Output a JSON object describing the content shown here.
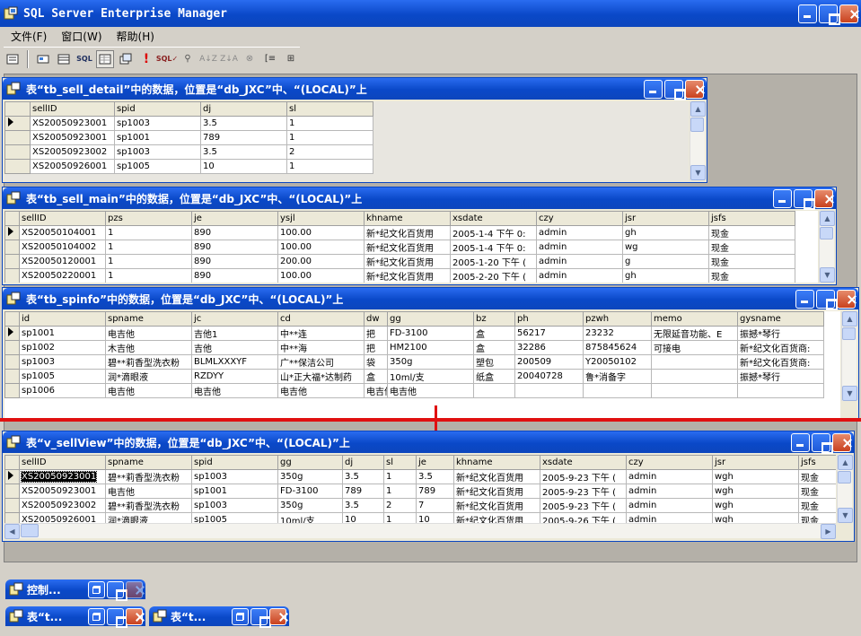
{
  "app": {
    "title": "SQL Server Enterprise Manager"
  },
  "menu": [
    {
      "label": "文件(F)"
    },
    {
      "label": "窗口(W)"
    },
    {
      "label": "帮助(H)"
    }
  ],
  "toolbar_icons": [
    "properties-icon",
    "show-diagram-pane-icon",
    "show-grid-pane-icon",
    "show-sql-pane-icon",
    "show-results-pane-icon",
    "change-query-type-icon",
    "run-icon",
    "verify-sql-icon",
    "remove-filter-icon",
    "sort-ascending-icon",
    "sort-descending-icon",
    "clear-filter-icon",
    "group-by-icon",
    "add-table-icon"
  ],
  "win1": {
    "title": "表“tb_sell_detail”中的数据，位置是“db_JXC”中、“(LOCAL)”上",
    "columns": [
      "sellID",
      "spid",
      "dj",
      "sl"
    ],
    "rows": [
      [
        "XS20050923001",
        "sp1003",
        "3.5",
        "1"
      ],
      [
        "XS20050923001",
        "sp1001",
        "789",
        "1"
      ],
      [
        "XS20050923002",
        "sp1003",
        "3.5",
        "2"
      ],
      [
        "XS20050926001",
        "sp1005",
        "10",
        "1"
      ]
    ]
  },
  "win2": {
    "title": "表“tb_sell_main”中的数据，位置是“db_JXC”中、“(LOCAL)”上",
    "columns": [
      "sellID",
      "pzs",
      "je",
      "ysjl",
      "khname",
      "xsdate",
      "czy",
      "jsr",
      "jsfs"
    ],
    "rows": [
      [
        "XS20050104001",
        "1",
        "890",
        "100.00",
        "新*纪文化百货用",
        "2005-1-4 下午 0:",
        "admin",
        "gh",
        "现金"
      ],
      [
        "XS20050104002",
        "1",
        "890",
        "100.00",
        "新*纪文化百货用",
        "2005-1-4 下午 0:",
        "admin",
        "wg",
        "现金"
      ],
      [
        "XS20050120001",
        "1",
        "890",
        "200.00",
        "新*纪文化百货用",
        "2005-1-20 下午 (",
        "admin",
        "g",
        "现金"
      ],
      [
        "XS20050220001",
        "1",
        "890",
        "100.00",
        "新*纪文化百货用",
        "2005-2-20 下午 (",
        "admin",
        "gh",
        "现金"
      ]
    ]
  },
  "win3": {
    "title": "表“tb_spinfo”中的数据，位置是“db_JXC”中、“(LOCAL)”上",
    "columns": [
      "id",
      "spname",
      "jc",
      "cd",
      "dw",
      "gg",
      "bz",
      "ph",
      "pzwh",
      "memo",
      "gysname"
    ],
    "rows": [
      [
        "sp1001",
        "电吉他",
        "吉他1",
        "中**连",
        "把",
        "FD-3100",
        "盒",
        "56217",
        "23232",
        "无限延音功能、E",
        "振撼*琴行"
      ],
      [
        "sp1002",
        "木吉他",
        "吉他",
        "中**海",
        "把",
        "HM2100",
        "盒",
        "32286",
        "875845624",
        "可接电",
        "新*纪文化百货商:"
      ],
      [
        "sp1003",
        "碧**莉香型洗衣粉",
        "BLMLXXXYF",
        "广**保洁公司",
        "袋",
        "350g",
        "塑包",
        "200509",
        "Y20050102",
        "",
        "新*纪文化百货商:"
      ],
      [
        "sp1005",
        "润*滴眼液",
        "RZDYY",
        "山*正大福*达制药",
        "盒",
        "10ml/支",
        "纸盒",
        "20040728",
        "鲁*消备字",
        "",
        "振撼*琴行"
      ],
      [
        "sp1006",
        "电吉他",
        "电吉他",
        "电吉他",
        "电吉他",
        "电吉他",
        "",
        "",
        "",
        "",
        ""
      ]
    ]
  },
  "win4": {
    "title": "表“v_sellView”中的数据，位置是“db_JXC”中、“(LOCAL)”上",
    "columns": [
      "sellID",
      "spname",
      "spid",
      "gg",
      "dj",
      "sl",
      "je",
      "khname",
      "xsdate",
      "czy",
      "jsr",
      "jsfs"
    ],
    "rows": [
      [
        "XS20050923001",
        "碧**莉香型洗衣粉",
        "sp1003",
        "350g",
        "3.5",
        "1",
        "3.5",
        "新*纪文化百货用",
        "2005-9-23 下午 (",
        "admin",
        "wgh",
        "现金"
      ],
      [
        "XS20050923001",
        "电吉他",
        "sp1001",
        "FD-3100",
        "789",
        "1",
        "789",
        "新*纪文化百货用",
        "2005-9-23 下午 (",
        "admin",
        "wgh",
        "现金"
      ],
      [
        "XS20050923002",
        "碧**莉香型洗衣粉",
        "sp1003",
        "350g",
        "3.5",
        "2",
        "7",
        "新*纪文化百货用",
        "2005-9-23 下午 (",
        "admin",
        "wgh",
        "现金"
      ],
      [
        "XS20050926001",
        "润*滴眼液",
        "sp1005",
        "10ml/支",
        "10",
        "1",
        "10",
        "新*纪文化百货用",
        "2005-9-26 下午 (",
        "admin",
        "wgh",
        "现金"
      ]
    ]
  },
  "minimized": [
    {
      "title": "控制..."
    },
    {
      "title": "表“t..."
    },
    {
      "title": "表“t..."
    }
  ]
}
